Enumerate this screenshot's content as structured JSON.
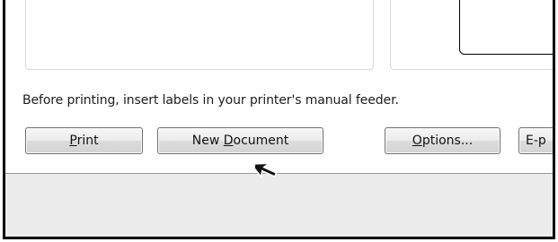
{
  "message": "Before printing, insert labels in your printer's manual feeder.",
  "buttons": {
    "print": {
      "label": "Print",
      "mnemonic": "P",
      "rest": "rint"
    },
    "new_document": {
      "label": "New Document",
      "pre": "New ",
      "mnemonic": "D",
      "rest": "ocument"
    },
    "options": {
      "label": "Options...",
      "mnemonic": "O",
      "rest": "ptions..."
    },
    "email": {
      "label": "E-p"
    }
  },
  "cursor": {
    "type": "arrow-pointer",
    "target": "New Document button"
  }
}
